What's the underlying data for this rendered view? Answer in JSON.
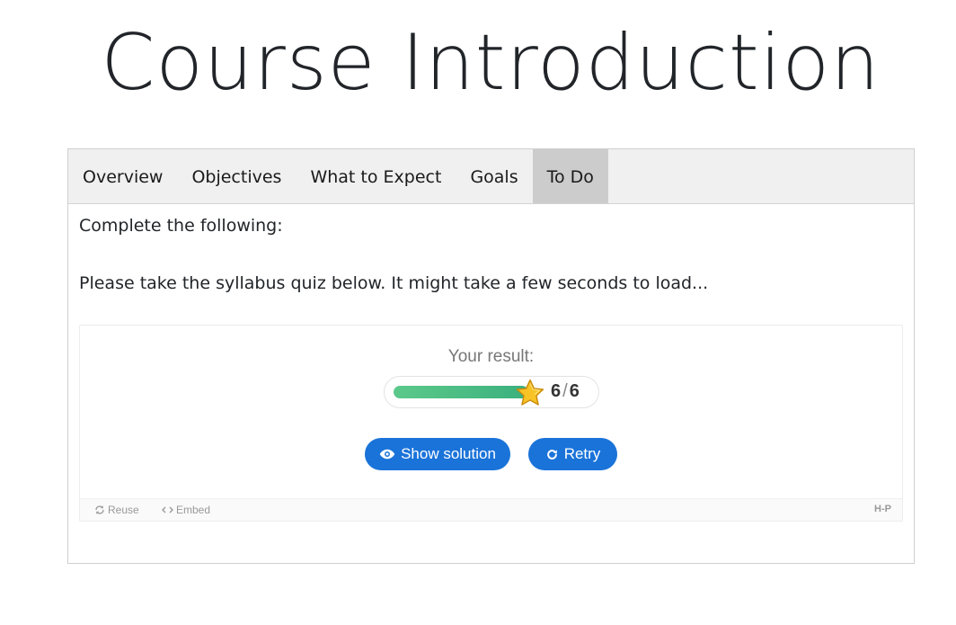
{
  "page": {
    "title": "Course Introduction"
  },
  "tabs": [
    {
      "label": "Overview",
      "active": false
    },
    {
      "label": "Objectives",
      "active": false
    },
    {
      "label": "What to Expect",
      "active": false
    },
    {
      "label": "Goals",
      "active": false
    },
    {
      "label": "To Do",
      "active": true
    }
  ],
  "content": {
    "intro": "Complete the following:",
    "instruction": "Please take the syllabus quiz below. It might take a few seconds to load..."
  },
  "quiz": {
    "result_label": "Your result:",
    "score": 6,
    "max_score": 6,
    "score_separator": "/",
    "progress_fraction": 1.0,
    "show_solution_label": "Show solution",
    "retry_label": "Retry",
    "accent_color": "#1a73d9",
    "star_icon": "star-icon"
  },
  "footer": {
    "reuse_label": "Reuse",
    "embed_label": "Embed",
    "logo_text": "H-P"
  }
}
